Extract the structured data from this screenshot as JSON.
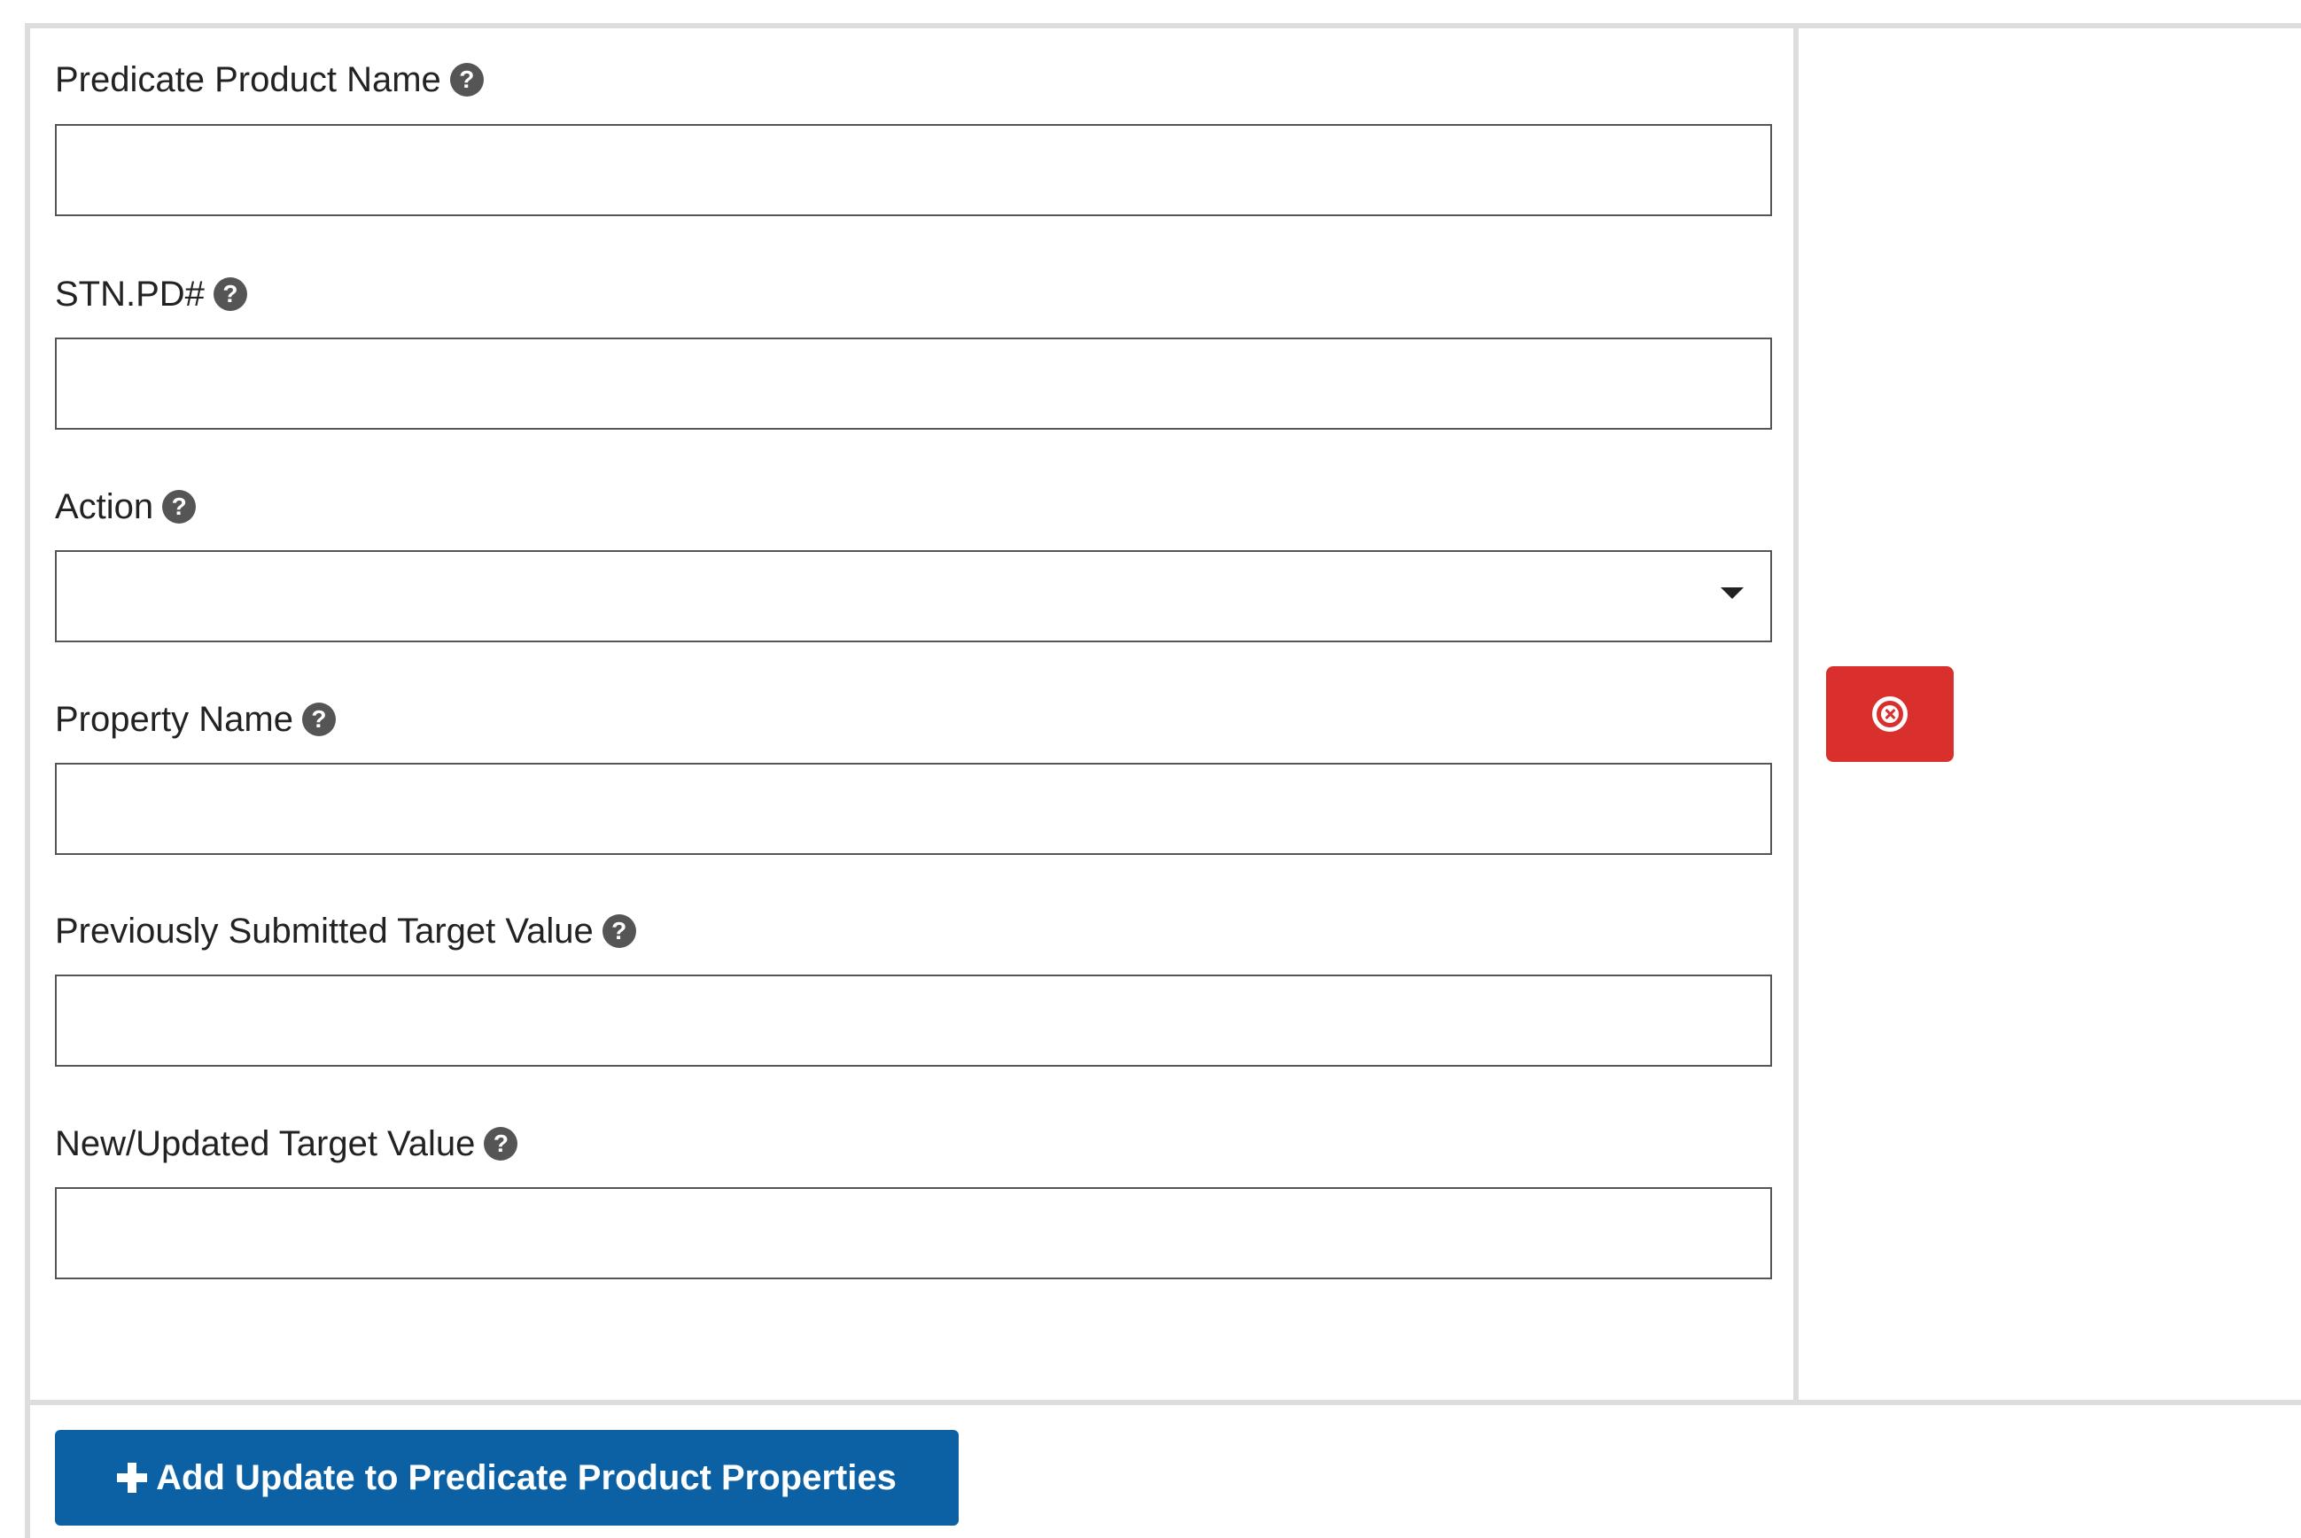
{
  "form": {
    "fields": [
      {
        "label": "Predicate Product Name",
        "value": "",
        "help_icon": "question-circle-icon"
      },
      {
        "label": "STN.PD#",
        "value": "",
        "help_icon": "question-circle-icon"
      },
      {
        "label": "Action",
        "value": "",
        "help_icon": "question-circle-icon",
        "control": "select",
        "caret_icon": "caret-down-icon"
      },
      {
        "label": "Property Name",
        "value": "",
        "help_icon": "question-circle-icon"
      },
      {
        "label": "Previously Submitted Target Value",
        "value": "",
        "help_icon": "question-circle-icon"
      },
      {
        "label": "New/Updated Target Value",
        "value": "",
        "help_icon": "question-circle-icon"
      }
    ],
    "help_glyph": "?"
  },
  "remove_button": {
    "icon": "times-circle-icon",
    "color": "#d9302d"
  },
  "add_button": {
    "icon": "plus-icon",
    "label": "Add Update to Predicate Product Properties",
    "color": "#0b61a4"
  }
}
